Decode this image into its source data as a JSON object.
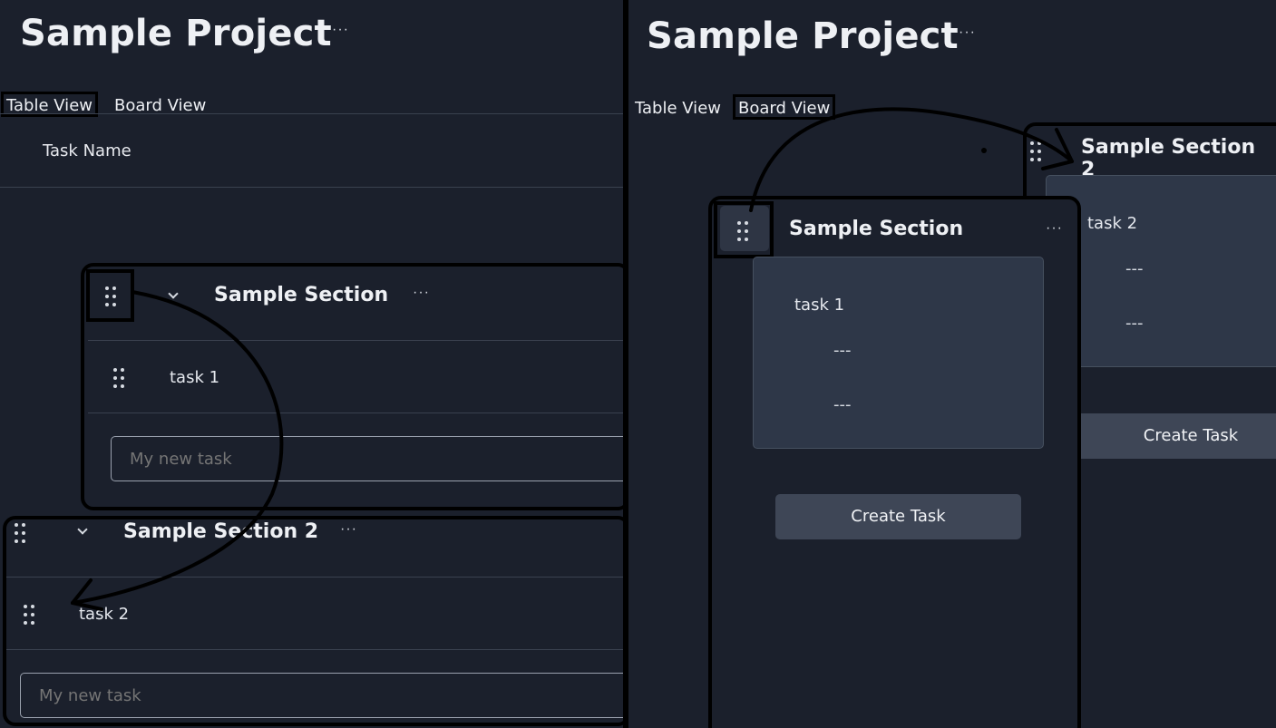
{
  "table_view": {
    "project_title": "Sample Project",
    "more_label": "···",
    "tabs": {
      "table": "Table View",
      "board": "Board View"
    },
    "active_tab": "Table View",
    "column_header": "Task Name",
    "sections": [
      {
        "title": "Sample Section",
        "tasks": [
          "task 1"
        ],
        "new_task_placeholder": "My new task"
      },
      {
        "title": "Sample Section 2",
        "tasks": [
          "task 2"
        ],
        "new_task_placeholder": "My new task"
      }
    ]
  },
  "board_view": {
    "project_title": "Sample Project",
    "more_label": "···",
    "tabs": {
      "table": "Table View",
      "board": "Board View"
    },
    "active_tab": "Board View",
    "columns": [
      {
        "title": "Sample Section",
        "cards": [
          {
            "name": "task 1",
            "field1": "---",
            "field2": "---"
          }
        ],
        "create_button": "Create Task"
      },
      {
        "title": "Sample Section 2",
        "cards": [
          {
            "name": "task 2",
            "field1": "---",
            "field2": "---"
          }
        ],
        "create_button": "Create Task"
      }
    ]
  },
  "colors": {
    "background": "#1b202c",
    "card": "#2e3748",
    "button": "#3e4656",
    "annotation": "#000000"
  },
  "icons": [
    "drag-handle-icon",
    "chevron-down-icon",
    "more-icon"
  ]
}
